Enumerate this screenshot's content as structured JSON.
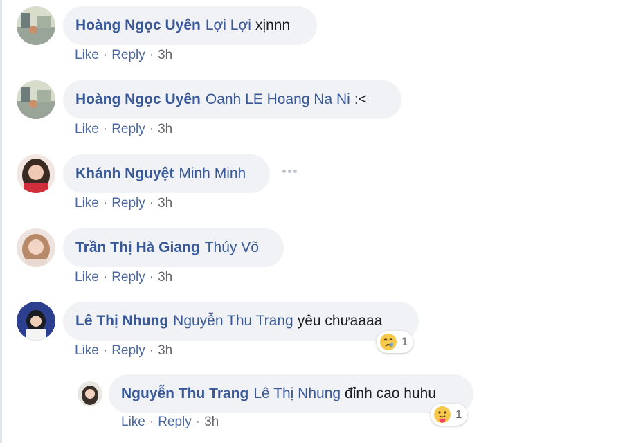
{
  "comments": [
    {
      "author": "Hoàng Ngọc Uyên",
      "mention": "Lợi Lợi",
      "text": "xịnnn",
      "actions": {
        "like": "Like",
        "reply": "Reply",
        "time": "3h"
      }
    },
    {
      "author": "Hoàng Ngọc Uyên",
      "mention": "Oanh LE Hoang Na Ni",
      "text": ":<",
      "actions": {
        "like": "Like",
        "reply": "Reply",
        "time": "3h"
      }
    },
    {
      "author": "Khánh Nguyệt",
      "mention": "Minh Minh",
      "text": "",
      "actions": {
        "like": "Like",
        "reply": "Reply",
        "time": "3h"
      }
    },
    {
      "author": "Trần Thị Hà Giang",
      "mention": "Thúy Võ",
      "text": "",
      "actions": {
        "like": "Like",
        "reply": "Reply",
        "time": "3h"
      }
    },
    {
      "author": "Lê Thị Nhung",
      "mention": "Nguyễn Thu Trang",
      "text": "yêu chưaaaa",
      "reaction": {
        "icon": "sad-reaction-icon",
        "count": "1"
      },
      "actions": {
        "like": "Like",
        "reply": "Reply",
        "time": "3h"
      }
    }
  ],
  "reply": {
    "author": "Nguyễn Thu Trang",
    "mention": "Lê Thị Nhung",
    "text": "đỉnh cao huhu",
    "reaction": {
      "icon": "care-reaction-icon",
      "count": "1"
    },
    "actions": {
      "like": "Like",
      "reply": "Reply",
      "time": "3h"
    }
  },
  "colors": {
    "author": "#385898",
    "bubble": "#f0f2f5",
    "meta": "#65676b"
  }
}
